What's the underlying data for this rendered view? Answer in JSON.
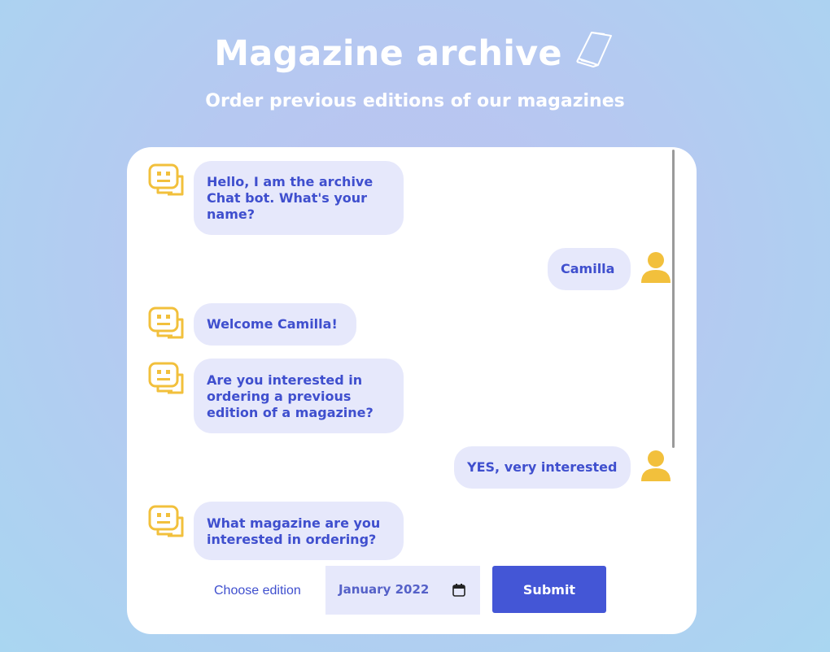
{
  "header": {
    "title": "Magazine archive",
    "subtitle": "Order previous editions of our magazines",
    "title_icon": "magazine-pages-icon"
  },
  "chat": {
    "messages": [
      {
        "sender": "bot",
        "text": "Hello, I am the archive Chat bot. What's your name?"
      },
      {
        "sender": "user",
        "text": "Camilla"
      },
      {
        "sender": "bot",
        "text": "Welcome Camilla!"
      },
      {
        "sender": "bot",
        "text": "Are you interested in ordering a previous edition of a magazine?"
      },
      {
        "sender": "user",
        "text": "YES, very interested"
      },
      {
        "sender": "bot",
        "text": "What magazine are you interested in ordering?"
      }
    ]
  },
  "form": {
    "label": "Choose edition",
    "date_value": "January 2022",
    "submit_label": "Submit"
  },
  "colors": {
    "accent": "#4456d6",
    "bubble": "#e6e8fb",
    "bubble_text": "#3f4fce",
    "avatar": "#f2c03c"
  },
  "icons": {
    "bot": "robot-icon",
    "user": "user-icon",
    "date": "calendar-icon"
  }
}
